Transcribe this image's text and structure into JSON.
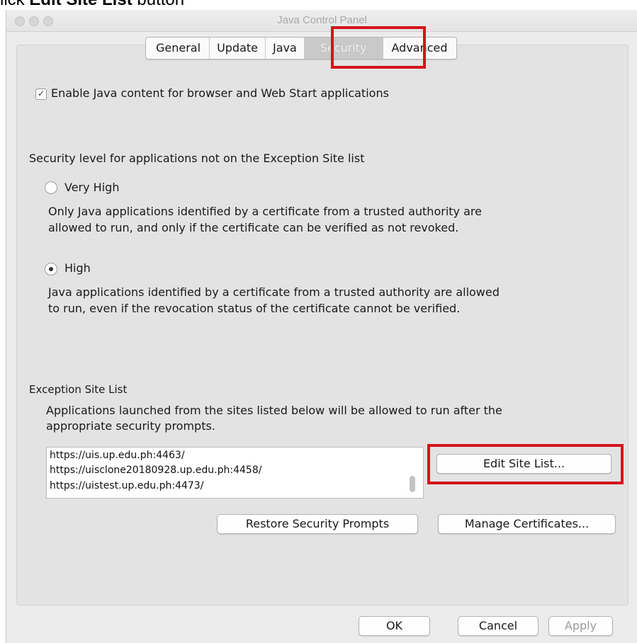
{
  "caption": {
    "prefix": "lick ",
    "bold_text": "Edit Site List",
    "suffix": " button"
  },
  "window": {
    "title": "Java Control Panel"
  },
  "tabs": [
    {
      "label": "General"
    },
    {
      "label": "Update"
    },
    {
      "label": "Java"
    },
    {
      "label": "Security"
    },
    {
      "label": "Advanced"
    }
  ],
  "selected_tab": "Security",
  "enable_java": {
    "label": "Enable Java content for browser and Web Start applications",
    "checked": true,
    "check_glyph": "✓"
  },
  "security_level": {
    "heading": "Security level for applications not on the Exception Site list",
    "options": [
      {
        "label": "Very High",
        "selected": false,
        "description_lines": [
          "Only Java applications identified by a certificate from a trusted authority are",
          "allowed to run, and only if the certificate can be verified as not revoked."
        ]
      },
      {
        "label": "High",
        "selected": true,
        "description_lines": [
          "Java applications identified by a certificate from a trusted authority are allowed",
          "to run, even if the revocation status of the certificate cannot be verified."
        ]
      }
    ]
  },
  "exception_site_list": {
    "heading": "Exception Site List",
    "description_lines": [
      "Applications launched from the sites listed below will be allowed to run after the",
      "appropriate security prompts."
    ],
    "sites": [
      "https://uis.up.edu.ph:4463/",
      "https://uisclone20180928.up.edu.ph:4458/",
      "https://uistest.up.edu.ph:4473/"
    ],
    "edit_button": "Edit Site List..."
  },
  "buttons": {
    "restore_prompts": "Restore Security Prompts",
    "manage_certificates": "Manage Certificates...",
    "ok": "OK",
    "cancel": "Cancel",
    "apply": "Apply"
  },
  "colors": {
    "highlight": "#d4141b",
    "window_bg": "#ececec",
    "panel_bg": "#e3e3e3"
  }
}
